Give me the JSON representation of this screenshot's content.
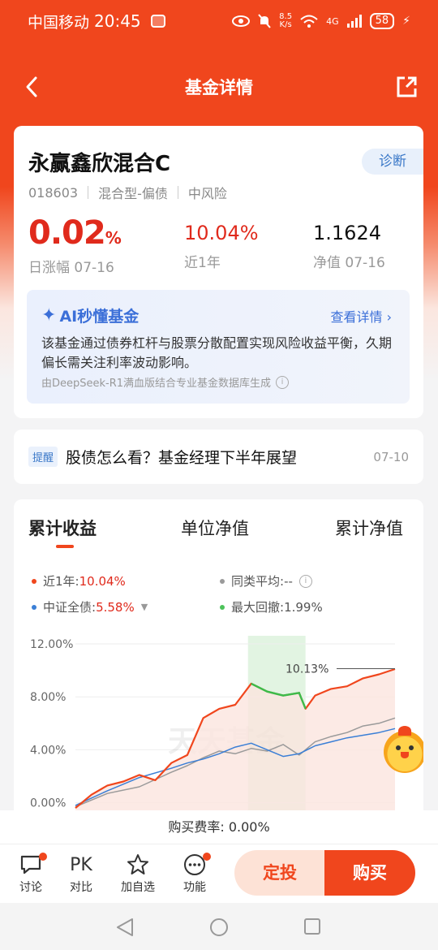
{
  "status_bar": {
    "carrier": "中国移动",
    "time": "20:45",
    "net_speed_value": "8.5",
    "net_speed_unit": "K/s",
    "network_type": "4G",
    "battery": "58"
  },
  "nav": {
    "title": "基金详情"
  },
  "fund": {
    "name": "永赢鑫欣混合C",
    "diagnose_label": "诊断",
    "code": "018603",
    "type": "混合型-偏债",
    "risk": "中风险",
    "daily_change_value": "0.02",
    "daily_change_unit": "%",
    "daily_change_label": "日涨幅 07-16",
    "year_return": "10.04%",
    "year_return_label": "近1年",
    "nav_value": "1.1624",
    "nav_label": "净值 07-16"
  },
  "ai_summary": {
    "title": "AI秒懂基金",
    "more_label": "查看详情",
    "text": "该基金通过债券杠杆与股票分散配置实现风险收益平衡，久期偏长需关注利率波动影响。",
    "source": "由DeepSeek-R1满血版结合专业基金数据库生成"
  },
  "reminder": {
    "tag": "提醒",
    "text": "股债怎么看？基金经理下半年展望",
    "date": "07-10"
  },
  "chart_tabs": [
    "累计收益",
    "单位净值",
    "累计净值"
  ],
  "legend": {
    "fund_label": "近1年:",
    "fund_value": "10.04%",
    "peer_label": "同类平均:",
    "peer_value": "--",
    "bench_label": "中证全债:",
    "bench_value": "5.58%",
    "drawdown_label": "最大回撤:",
    "drawdown_value": "1.99%"
  },
  "chart_data": {
    "type": "line",
    "ytick_labels": [
      "12.00%",
      "8.00%",
      "4.00%",
      "0.00%"
    ],
    "ylim": [
      0,
      12
    ],
    "peak_annotation": "10.13%",
    "max_drawdown_window": [
      0.54,
      0.72
    ],
    "series": [
      {
        "name": "近1年",
        "color": "#f0461d",
        "x": [
          0,
          0.05,
          0.1,
          0.15,
          0.2,
          0.25,
          0.3,
          0.35,
          0.4,
          0.45,
          0.5,
          0.55,
          0.6,
          0.65,
          0.7,
          0.72,
          0.75,
          0.8,
          0.85,
          0.9,
          0.95,
          1.0
        ],
        "values": [
          -0.4,
          0.6,
          1.3,
          1.6,
          2.1,
          1.7,
          3.0,
          3.6,
          6.4,
          7.1,
          7.4,
          9.0,
          8.4,
          8.1,
          8.3,
          7.1,
          8.1,
          8.6,
          8.8,
          9.4,
          9.7,
          10.1
        ]
      },
      {
        "name": "同类平均",
        "color": "#9a9a9a",
        "x": [
          0,
          0.1,
          0.2,
          0.3,
          0.35,
          0.4,
          0.45,
          0.5,
          0.55,
          0.6,
          0.65,
          0.7,
          0.75,
          0.8,
          0.85,
          0.9,
          0.95,
          1.0
        ],
        "values": [
          -0.3,
          0.7,
          1.2,
          2.3,
          2.8,
          3.4,
          3.9,
          3.7,
          4.1,
          3.9,
          4.4,
          3.6,
          4.6,
          5.0,
          5.3,
          5.8,
          6.0,
          6.4
        ]
      },
      {
        "name": "中证全债",
        "color": "#3b7fd6",
        "x": [
          0,
          0.1,
          0.2,
          0.3,
          0.35,
          0.4,
          0.45,
          0.5,
          0.55,
          0.6,
          0.65,
          0.7,
          0.75,
          0.8,
          0.85,
          0.9,
          0.95,
          1.0
        ],
        "values": [
          -0.2,
          0.9,
          1.9,
          2.6,
          3.0,
          3.3,
          3.7,
          4.2,
          4.5,
          4.0,
          3.5,
          3.7,
          4.3,
          4.6,
          4.9,
          5.1,
          5.3,
          5.6
        ]
      }
    ]
  },
  "watermark": "天天基金",
  "fee": {
    "label": "购买费率:",
    "value": "0.00%"
  },
  "actions": {
    "discuss": "讨论",
    "pk_icon_text": "PK",
    "compare": "对比",
    "watchlist": "加自选",
    "functions": "功能",
    "sip": "定投",
    "buy": "购买"
  }
}
